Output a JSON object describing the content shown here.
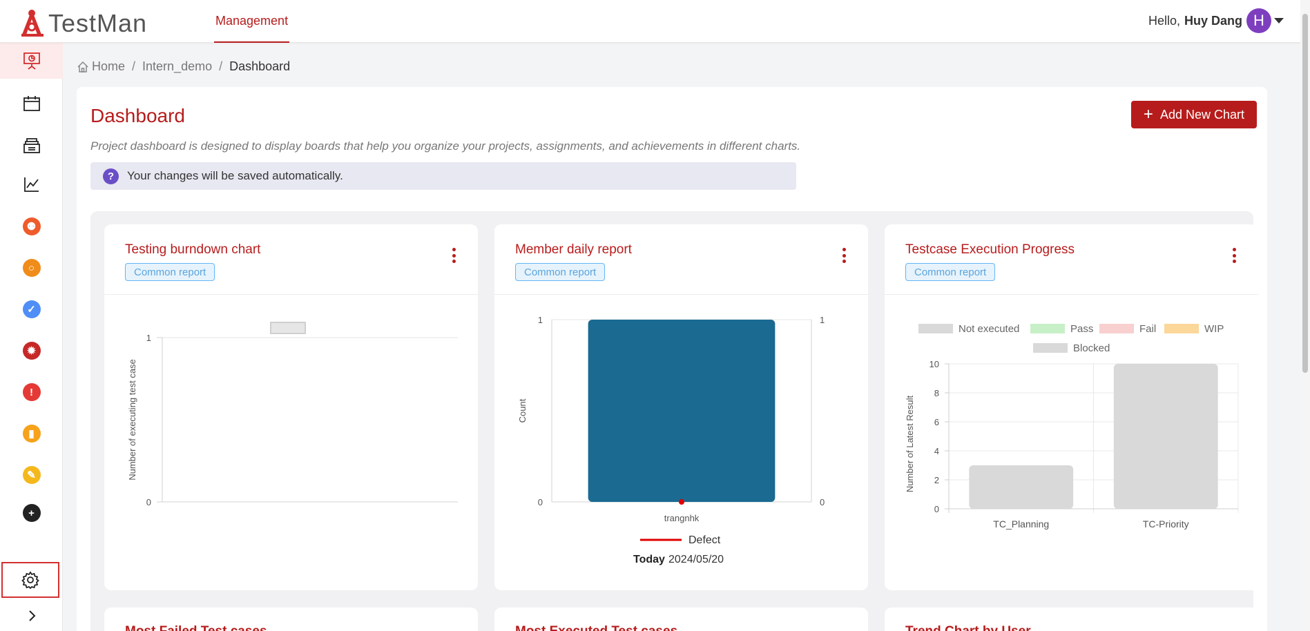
{
  "app": {
    "logo_text": "TestMan"
  },
  "header": {
    "nav_tab": "Management",
    "greeting": "Hello,",
    "user_name": "Huy Dang",
    "avatar_letter": "H"
  },
  "sidebar": {
    "items": [
      {
        "icon": "dashboard-presentation-icon",
        "color": "#d32f2f",
        "active": true
      },
      {
        "icon": "calendar-icon"
      },
      {
        "icon": "test-suite-stack-icon"
      },
      {
        "icon": "line-chart-icon"
      },
      {
        "icon": "flow-icon",
        "color": "#ef5b2a"
      },
      {
        "icon": "lightbulb-icon",
        "color": "#f08c19"
      },
      {
        "icon": "check-circle-icon",
        "color": "#4f8ef7"
      },
      {
        "icon": "bug-icon",
        "color": "#c62828"
      },
      {
        "icon": "alert-icon",
        "color": "#e53935"
      },
      {
        "icon": "task-icon",
        "color": "#f7a21a"
      },
      {
        "icon": "pencil-icon",
        "color": "#f5b81c"
      },
      {
        "icon": "add-circle-icon",
        "color": "#222222"
      },
      {
        "icon": "settings-gear-icon",
        "highlighted": true
      },
      {
        "icon": "chevron-right-icon"
      }
    ]
  },
  "breadcrumb": {
    "home": "Home",
    "project": "Intern_demo",
    "current": "Dashboard",
    "sep": "/"
  },
  "page": {
    "title": "Dashboard",
    "add_button": "Add New Chart",
    "description": "Project dashboard is designed to display boards that help you organize your projects, assignments, and achievements in different charts.",
    "info_text": "Your changes will be saved automatically."
  },
  "cards": [
    {
      "title": "Testing burndown chart",
      "badge": "Common report"
    },
    {
      "title": "Member daily report",
      "badge": "Common report"
    },
    {
      "title": "Testcase Execution Progress",
      "badge": "Common report"
    }
  ],
  "cards_row2": [
    {
      "title": "Most Failed Test cases"
    },
    {
      "title": "Most Executed Test cases"
    },
    {
      "title": "Trend Chart by User"
    }
  ],
  "colors": {
    "accent": "#b71c1c",
    "bar_blue": "#1a6a92",
    "grey_bar": "#d9d9d9"
  },
  "chart_data": [
    {
      "type": "line",
      "title": "Testing burndown chart",
      "ylabel": "Number of executing test case",
      "xlabel": "",
      "ylim": [
        0,
        1
      ],
      "yticks": [
        "0",
        "1"
      ],
      "series": [
        {
          "values": []
        }
      ]
    },
    {
      "type": "bar",
      "title": "Member daily report",
      "ylabel": "Count",
      "categories": [
        "trangnhk"
      ],
      "ylim": [
        0,
        1
      ],
      "yticks_left": [
        "0",
        "1"
      ],
      "yticks_right": [
        "0",
        "1"
      ],
      "series": [
        {
          "name": "Count",
          "values": [
            1
          ]
        },
        {
          "name": "Defect",
          "type": "line",
          "values": [
            0
          ]
        }
      ],
      "legend": "bottom",
      "footer_label": "Today",
      "footer_date": "2024/05/20"
    },
    {
      "type": "bar",
      "title": "Testcase Execution Progress",
      "ylabel": "Number of Latest Result",
      "categories": [
        "TC_Planning",
        "TC-Priority"
      ],
      "ylim": [
        0,
        10
      ],
      "yticks": [
        "0",
        "2",
        "4",
        "6",
        "8",
        "10"
      ],
      "legend": "top",
      "legend_items": [
        {
          "name": "Not executed",
          "color": "#d9d9d9"
        },
        {
          "name": "Pass",
          "color": "#c8f0c8"
        },
        {
          "name": "Fail",
          "color": "#f8d0d0"
        },
        {
          "name": "WIP",
          "color": "#fbd79a"
        },
        {
          "name": "Blocked",
          "color": "#d9d9d9"
        }
      ],
      "series": [
        {
          "name": "Not executed",
          "values": [
            3,
            10
          ]
        },
        {
          "name": "Pass",
          "values": [
            0,
            0
          ]
        },
        {
          "name": "Fail",
          "values": [
            0,
            0
          ]
        },
        {
          "name": "WIP",
          "values": [
            0,
            0
          ]
        },
        {
          "name": "Blocked",
          "values": [
            0,
            0
          ]
        }
      ]
    }
  ]
}
